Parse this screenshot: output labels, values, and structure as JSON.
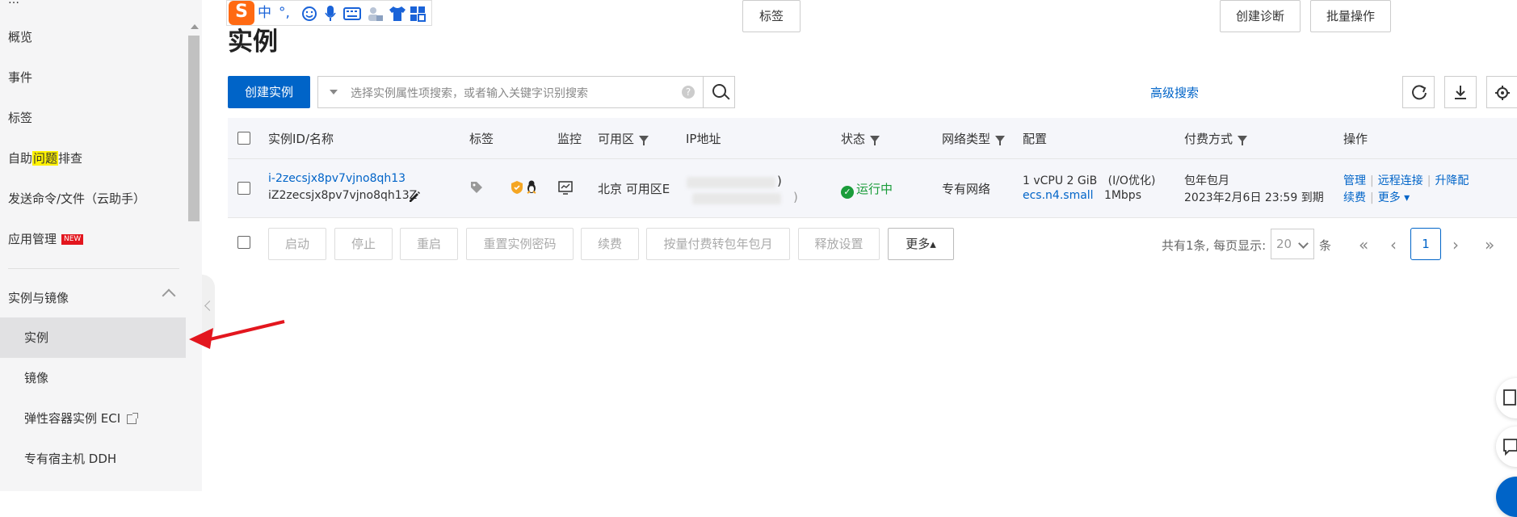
{
  "sidebar": {
    "top_cut": "…",
    "items": [
      {
        "label": "概览"
      },
      {
        "label": "事件"
      },
      {
        "label": "标签"
      },
      {
        "label_pre": "自助",
        "label_hl": "问题",
        "label_post": "排查"
      },
      {
        "label": "发送命令/文件（云助手）"
      },
      {
        "label": "应用管理",
        "badge": "NEW"
      }
    ],
    "group_title": "实例与镜像",
    "sub_items": [
      {
        "label": "实例",
        "active": true
      },
      {
        "label": "镜像"
      },
      {
        "label": "弹性容器实例 ECI"
      },
      {
        "label": "专有宿主机 DDH"
      }
    ]
  },
  "ime": {
    "logo": "S",
    "lang": "中",
    "punct": "°,"
  },
  "page": {
    "title": "实例"
  },
  "toolbar": {
    "create_label": "创建实例",
    "search_placeholder": "选择实例属性项搜索，或者输入关键字识别搜索",
    "help": "?",
    "tag_label": "标签",
    "advanced_search": "高级搜索",
    "diagnose_label": "创建诊断",
    "batch_label": "批量操作"
  },
  "table": {
    "headers": {
      "id": "实例ID/名称",
      "tag": "标签",
      "monitor": "监控",
      "zone": "可用区",
      "ip": "IP地址",
      "status": "状态",
      "network": "网络类型",
      "config": "配置",
      "billing": "付费方式",
      "actions": "操作"
    },
    "rows": [
      {
        "id": "i-2zecsjx8pv7vjno8qh13",
        "name": "iZ2zecsjx8pv7vjno8qh13Z",
        "zone": "北京 可用区E",
        "ip_suffix_1": ")",
        "ip_suffix_2": ")",
        "status": "运行中",
        "network": "专有网络",
        "config_spec": "1 vCPU 2 GiB",
        "config_opt": "(I/O优化)",
        "config_type": "ecs.n4.small",
        "config_bw": "1Mbps",
        "billing_type": "包年包月",
        "billing_expire": "2023年2月6日 23:59 到期",
        "actions": {
          "manage": "管理",
          "remote": "远程连接",
          "upgrade": "升降配",
          "renew": "续费",
          "more": "更多"
        }
      }
    ]
  },
  "footer": {
    "buttons": [
      "启动",
      "停止",
      "重启",
      "重置实例密码",
      "续费",
      "按量付费转包年包月",
      "释放设置"
    ],
    "more": "更多▴",
    "summary": "共有1条, 每页显示:",
    "page_size": "20",
    "unit": "条",
    "current_page": "1",
    "first": "«",
    "prev": "‹",
    "next": "›",
    "last": "»"
  },
  "colors": {
    "primary": "#0064c8",
    "status_green": "#1a9c3a",
    "arrow_red": "#e3161e",
    "highlight": "#fff200"
  }
}
